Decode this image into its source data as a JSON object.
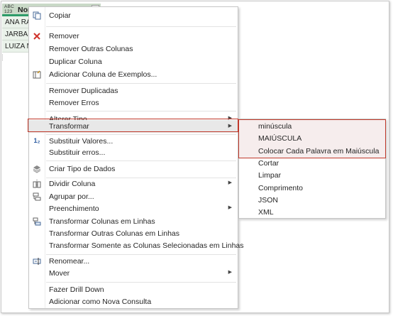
{
  "grid": {
    "type_icon_line1": "ABC",
    "type_icon_line2": "123",
    "column_name": "Nome",
    "rows": [
      "ANA RACHEL",
      "JARBAS M",
      "LUIZA MARIA"
    ]
  },
  "menu": {
    "items": {
      "copy": "Copiar",
      "remove": "Remover",
      "remove_other": "Remover Outras Colunas",
      "duplicate": "Duplicar Coluna",
      "add_from_examples": "Adicionar Coluna de Exemplos...",
      "remove_duplicates": "Remover Duplicadas",
      "remove_errors": "Remover Erros",
      "change_type": "Alterar Tipo",
      "transform": "Transformar",
      "replace_values": "Substituir Valores...",
      "replace_errors": "Substituir erros...",
      "create_data_type": "Criar Tipo de Dados",
      "split_column": "Dividir Coluna",
      "group_by": "Agrupar por...",
      "fill": "Preenchimento",
      "unpivot": "Transformar Colunas em Linhas",
      "unpivot_other": "Transformar Outras Colunas em Linhas",
      "unpivot_selected": "Transformar Somente as Colunas Selecionadas em Linhas",
      "rename": "Renomear...",
      "move": "Mover",
      "drill_down": "Fazer Drill Down",
      "add_as_query": "Adicionar como Nova Consulta"
    }
  },
  "submenu": {
    "items": [
      "minúscula",
      "MAIÚSCULA",
      "Colocar Cada Palavra em Maiúscula",
      "Cortar",
      "Limpar",
      "Comprimento",
      "JSON",
      "XML"
    ]
  },
  "colors": {
    "highlight_border": "#c0392b",
    "header_accent": "#2e9c6a"
  }
}
